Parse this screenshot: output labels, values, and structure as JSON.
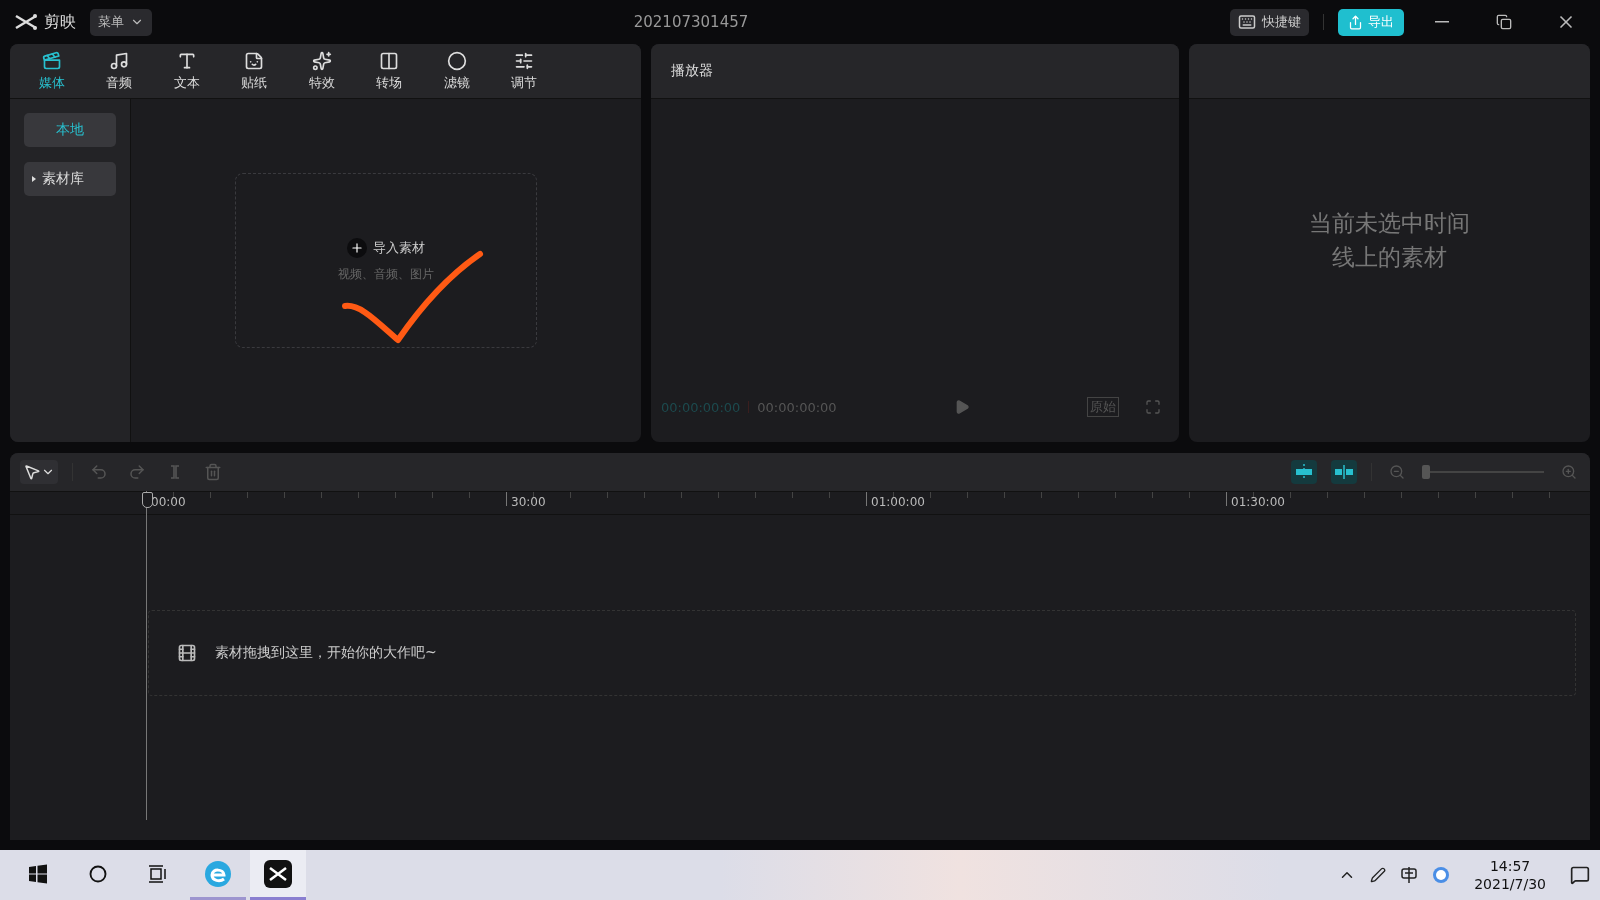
{
  "app": {
    "name": "剪映",
    "menu": "菜单",
    "project_title": "202107301457",
    "shortcuts": "快捷键",
    "export": "导出"
  },
  "tabs": [
    {
      "label": "媒体",
      "selected": true
    },
    {
      "label": "音频",
      "selected": false
    },
    {
      "label": "文本",
      "selected": false
    },
    {
      "label": "贴纸",
      "selected": false
    },
    {
      "label": "特效",
      "selected": false
    },
    {
      "label": "转场",
      "selected": false
    },
    {
      "label": "滤镜",
      "selected": false
    },
    {
      "label": "调节",
      "selected": false
    }
  ],
  "sidebar": {
    "items": [
      {
        "label": "本地",
        "selected": true,
        "kind": "plain"
      },
      {
        "label": "素材库",
        "selected": false,
        "kind": "folder",
        "expanded": false
      }
    ]
  },
  "import": {
    "label": "导入素材",
    "hint": "视频、音频、图片"
  },
  "player": {
    "title": "播放器",
    "current_time": "00:00:00:00",
    "total_time": "00:00:00:00",
    "ratio": "原始"
  },
  "details": {
    "empty_lines": [
      "当前未选中时间",
      "线上的素材"
    ]
  },
  "timeline": {
    "ticks": [
      "00:00",
      "30:00",
      "01:00:00",
      "01:30:00"
    ],
    "zoom": {
      "level": 0.0
    },
    "drop_hint": "素材拖拽到这里，开始你的大作吧~"
  },
  "taskbar": {
    "time": "14:57",
    "date": "2021/7/30",
    "apps": [
      {
        "kind": "edge",
        "active": false
      },
      {
        "kind": "capcut",
        "active": true
      }
    ]
  }
}
